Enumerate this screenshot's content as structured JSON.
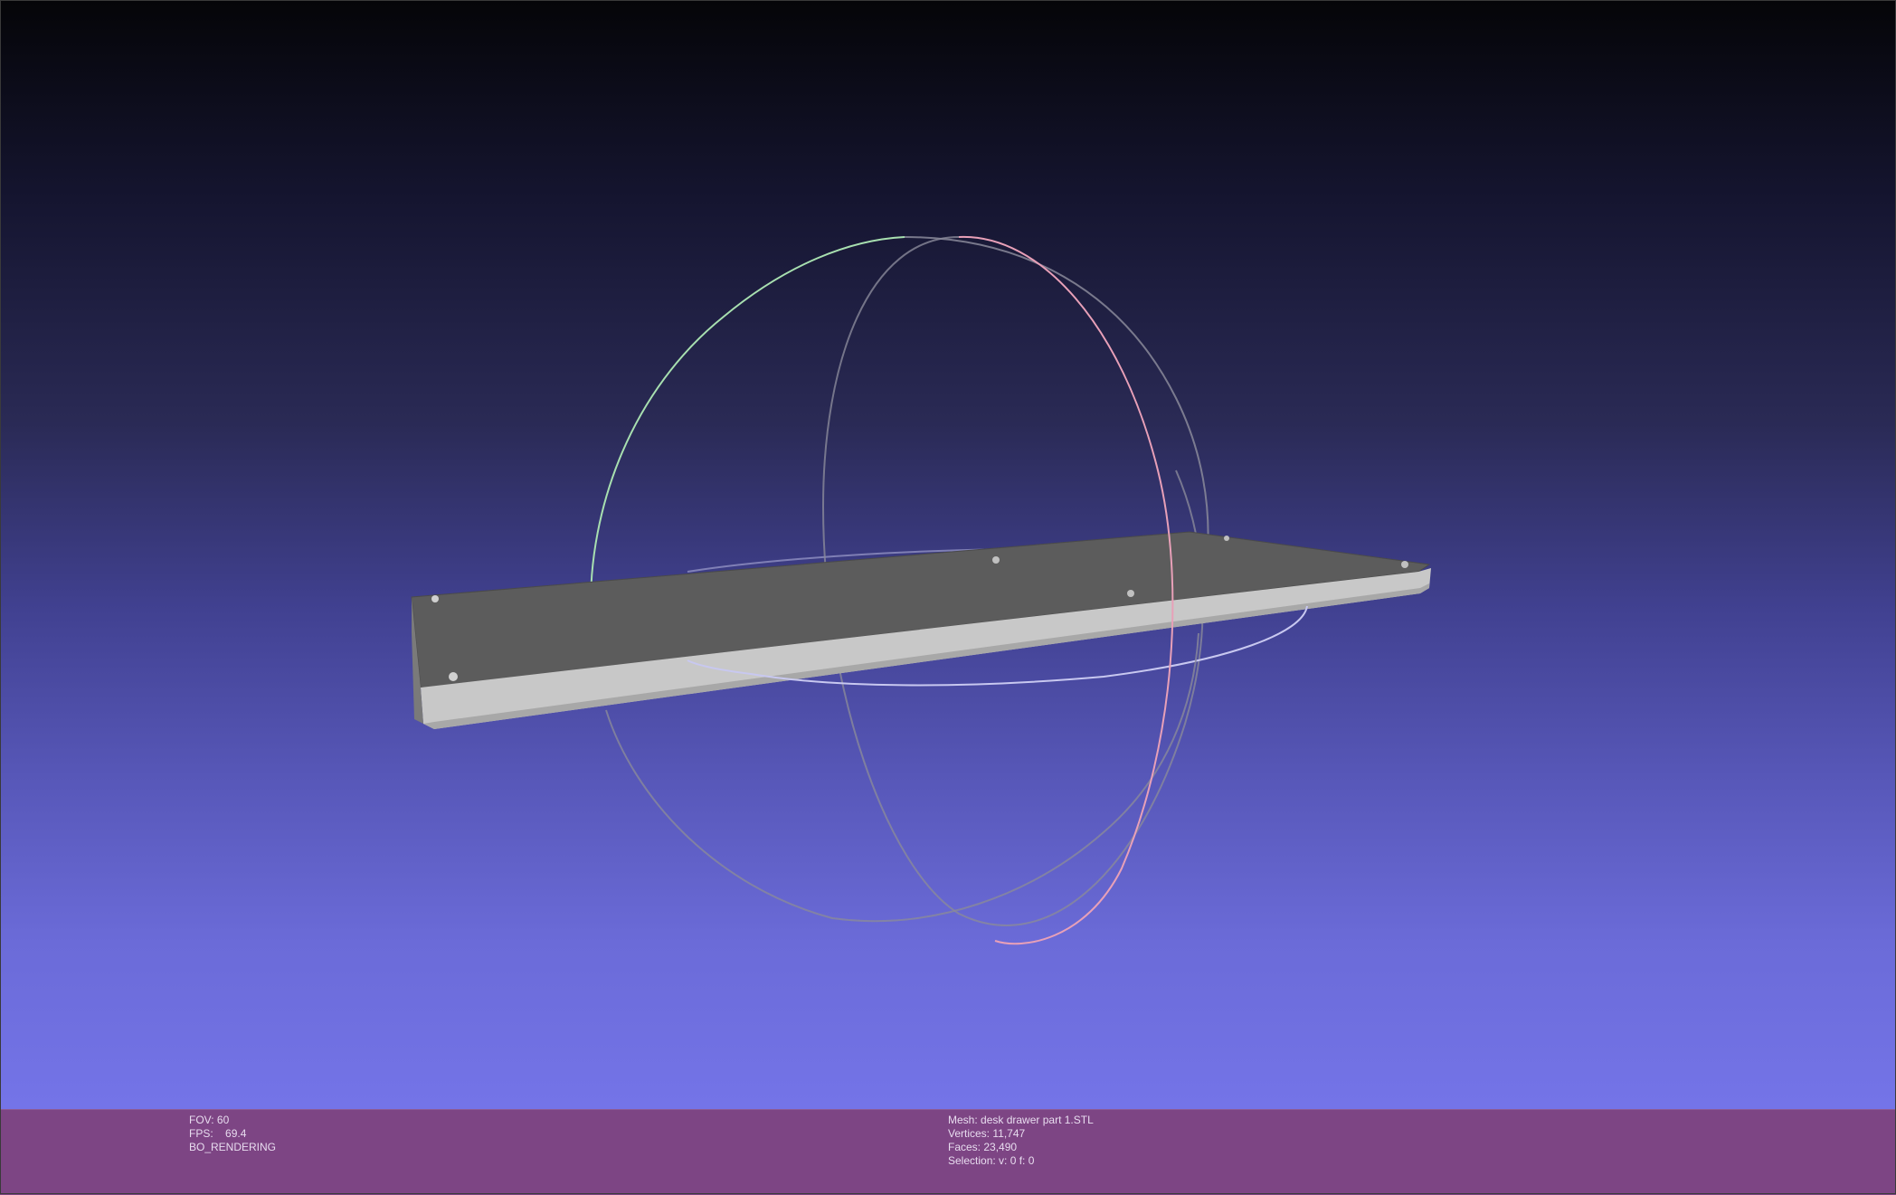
{
  "viewer": {
    "fov_label": "FOV:",
    "fov_value": "60",
    "fps_label": "FPS:",
    "fps_value": "69.4",
    "render_mode": "BO_RENDERING"
  },
  "mesh_info": {
    "mesh_label": "Mesh:",
    "mesh_name": "desk drawer part 1.STL",
    "vertices_label": "Vertices:",
    "vertices_value": "11,747",
    "faces_label": "Faces:",
    "faces_value": "23,490",
    "selection_label": "Selection:",
    "selection_value": "v: 0 f: 0"
  },
  "colors": {
    "status_bar": "#7d4584",
    "background_top": "#050508",
    "background_bottom": "#7474e8",
    "mesh_top": "#5c5c5c",
    "mesh_side": "#c8c8c8",
    "trackball_x": "#e8a0b8",
    "trackball_y": "#a8e0b0",
    "trackball_z": "#c8c8f0",
    "trackball_grey": "#8a8a9a"
  }
}
